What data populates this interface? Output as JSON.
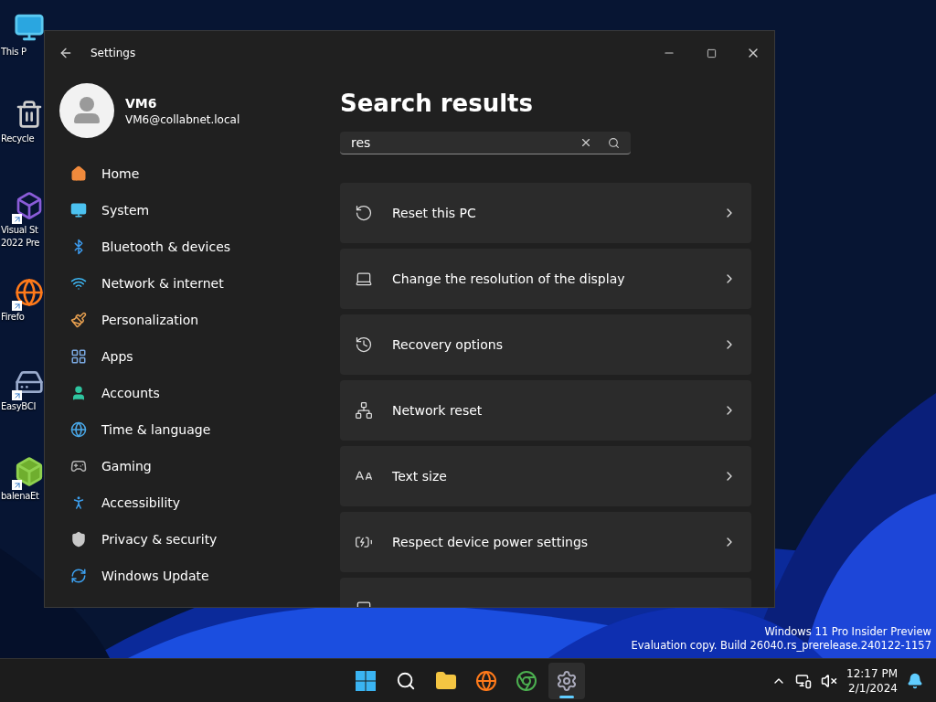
{
  "desktop_icons": [
    {
      "lines": [
        "This P"
      ],
      "shortcut": false
    },
    {
      "lines": [
        "Recycle"
      ],
      "shortcut": false
    },
    {
      "lines": [
        "Visual St",
        "2022 Pre"
      ],
      "shortcut": true
    },
    {
      "lines": [
        "Firefo"
      ],
      "shortcut": true
    },
    {
      "lines": [
        "EasyBCI"
      ],
      "shortcut": true
    },
    {
      "lines": [
        "balenaEt"
      ],
      "shortcut": true
    }
  ],
  "window": {
    "title": "Settings"
  },
  "account": {
    "name": "VM6",
    "email": "VM6@collabnet.local"
  },
  "sidebar": {
    "items": [
      {
        "label": "Home"
      },
      {
        "label": "System"
      },
      {
        "label": "Bluetooth & devices"
      },
      {
        "label": "Network & internet"
      },
      {
        "label": "Personalization"
      },
      {
        "label": "Apps"
      },
      {
        "label": "Accounts"
      },
      {
        "label": "Time & language"
      },
      {
        "label": "Gaming"
      },
      {
        "label": "Accessibility"
      },
      {
        "label": "Privacy & security"
      },
      {
        "label": "Windows Update"
      }
    ]
  },
  "page": {
    "title": "Search results",
    "search": {
      "value": "res"
    },
    "results": [
      {
        "label": "Reset this PC"
      },
      {
        "label": "Change the resolution of the display"
      },
      {
        "label": "Recovery options"
      },
      {
        "label": "Network reset"
      },
      {
        "label": "Text size"
      },
      {
        "label": "Respect device power settings"
      }
    ]
  },
  "watermark": [
    "Windows 11 Pro Insider Preview",
    "Evaluation copy. Build 26040.rs_prerelease.240122-1157"
  ],
  "taskbar": {
    "apps": [
      {
        "selected": false
      },
      {
        "selected": false
      },
      {
        "selected": false
      },
      {
        "selected": false
      },
      {
        "selected": false
      },
      {
        "selected": true
      }
    ],
    "time": "12:17 PM",
    "date": "2/1/2024"
  }
}
